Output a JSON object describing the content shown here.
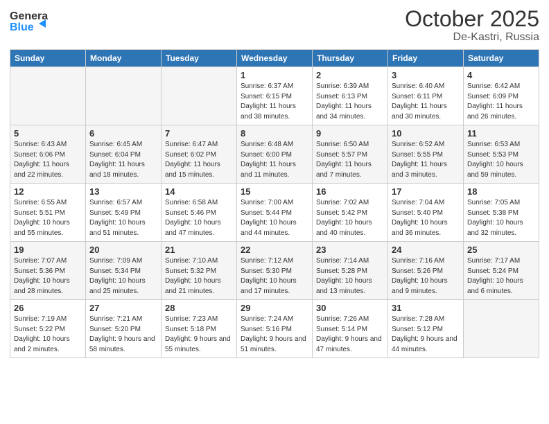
{
  "header": {
    "logo_general": "General",
    "logo_blue": "Blue",
    "month": "October 2025",
    "location": "De-Kastri, Russia"
  },
  "calendar": {
    "days_of_week": [
      "Sunday",
      "Monday",
      "Tuesday",
      "Wednesday",
      "Thursday",
      "Friday",
      "Saturday"
    ],
    "weeks": [
      [
        {
          "day": "",
          "info": ""
        },
        {
          "day": "",
          "info": ""
        },
        {
          "day": "",
          "info": ""
        },
        {
          "day": "1",
          "info": "Sunrise: 6:37 AM\nSunset: 6:15 PM\nDaylight: 11 hours\nand 38 minutes."
        },
        {
          "day": "2",
          "info": "Sunrise: 6:39 AM\nSunset: 6:13 PM\nDaylight: 11 hours\nand 34 minutes."
        },
        {
          "day": "3",
          "info": "Sunrise: 6:40 AM\nSunset: 6:11 PM\nDaylight: 11 hours\nand 30 minutes."
        },
        {
          "day": "4",
          "info": "Sunrise: 6:42 AM\nSunset: 6:09 PM\nDaylight: 11 hours\nand 26 minutes."
        }
      ],
      [
        {
          "day": "5",
          "info": "Sunrise: 6:43 AM\nSunset: 6:06 PM\nDaylight: 11 hours\nand 22 minutes."
        },
        {
          "day": "6",
          "info": "Sunrise: 6:45 AM\nSunset: 6:04 PM\nDaylight: 11 hours\nand 18 minutes."
        },
        {
          "day": "7",
          "info": "Sunrise: 6:47 AM\nSunset: 6:02 PM\nDaylight: 11 hours\nand 15 minutes."
        },
        {
          "day": "8",
          "info": "Sunrise: 6:48 AM\nSunset: 6:00 PM\nDaylight: 11 hours\nand 11 minutes."
        },
        {
          "day": "9",
          "info": "Sunrise: 6:50 AM\nSunset: 5:57 PM\nDaylight: 11 hours\nand 7 minutes."
        },
        {
          "day": "10",
          "info": "Sunrise: 6:52 AM\nSunset: 5:55 PM\nDaylight: 11 hours\nand 3 minutes."
        },
        {
          "day": "11",
          "info": "Sunrise: 6:53 AM\nSunset: 5:53 PM\nDaylight: 10 hours\nand 59 minutes."
        }
      ],
      [
        {
          "day": "12",
          "info": "Sunrise: 6:55 AM\nSunset: 5:51 PM\nDaylight: 10 hours\nand 55 minutes."
        },
        {
          "day": "13",
          "info": "Sunrise: 6:57 AM\nSunset: 5:49 PM\nDaylight: 10 hours\nand 51 minutes."
        },
        {
          "day": "14",
          "info": "Sunrise: 6:58 AM\nSunset: 5:46 PM\nDaylight: 10 hours\nand 47 minutes."
        },
        {
          "day": "15",
          "info": "Sunrise: 7:00 AM\nSunset: 5:44 PM\nDaylight: 10 hours\nand 44 minutes."
        },
        {
          "day": "16",
          "info": "Sunrise: 7:02 AM\nSunset: 5:42 PM\nDaylight: 10 hours\nand 40 minutes."
        },
        {
          "day": "17",
          "info": "Sunrise: 7:04 AM\nSunset: 5:40 PM\nDaylight: 10 hours\nand 36 minutes."
        },
        {
          "day": "18",
          "info": "Sunrise: 7:05 AM\nSunset: 5:38 PM\nDaylight: 10 hours\nand 32 minutes."
        }
      ],
      [
        {
          "day": "19",
          "info": "Sunrise: 7:07 AM\nSunset: 5:36 PM\nDaylight: 10 hours\nand 28 minutes."
        },
        {
          "day": "20",
          "info": "Sunrise: 7:09 AM\nSunset: 5:34 PM\nDaylight: 10 hours\nand 25 minutes."
        },
        {
          "day": "21",
          "info": "Sunrise: 7:10 AM\nSunset: 5:32 PM\nDaylight: 10 hours\nand 21 minutes."
        },
        {
          "day": "22",
          "info": "Sunrise: 7:12 AM\nSunset: 5:30 PM\nDaylight: 10 hours\nand 17 minutes."
        },
        {
          "day": "23",
          "info": "Sunrise: 7:14 AM\nSunset: 5:28 PM\nDaylight: 10 hours\nand 13 minutes."
        },
        {
          "day": "24",
          "info": "Sunrise: 7:16 AM\nSunset: 5:26 PM\nDaylight: 10 hours\nand 9 minutes."
        },
        {
          "day": "25",
          "info": "Sunrise: 7:17 AM\nSunset: 5:24 PM\nDaylight: 10 hours\nand 6 minutes."
        }
      ],
      [
        {
          "day": "26",
          "info": "Sunrise: 7:19 AM\nSunset: 5:22 PM\nDaylight: 10 hours\nand 2 minutes."
        },
        {
          "day": "27",
          "info": "Sunrise: 7:21 AM\nSunset: 5:20 PM\nDaylight: 9 hours\nand 58 minutes."
        },
        {
          "day": "28",
          "info": "Sunrise: 7:23 AM\nSunset: 5:18 PM\nDaylight: 9 hours\nand 55 minutes."
        },
        {
          "day": "29",
          "info": "Sunrise: 7:24 AM\nSunset: 5:16 PM\nDaylight: 9 hours\nand 51 minutes."
        },
        {
          "day": "30",
          "info": "Sunrise: 7:26 AM\nSunset: 5:14 PM\nDaylight: 9 hours\nand 47 minutes."
        },
        {
          "day": "31",
          "info": "Sunrise: 7:28 AM\nSunset: 5:12 PM\nDaylight: 9 hours\nand 44 minutes."
        },
        {
          "day": "",
          "info": ""
        }
      ]
    ]
  }
}
